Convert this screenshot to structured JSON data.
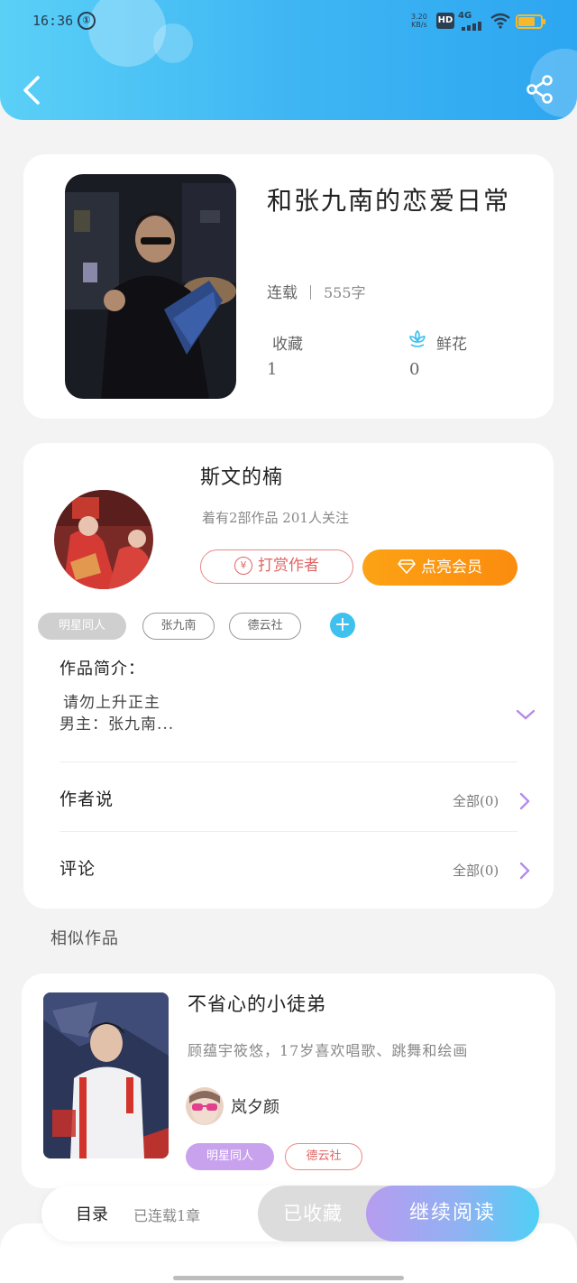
{
  "status_bar": {
    "time": "16:36",
    "notification_badge": "①",
    "net_speed_value": "3.20",
    "net_speed_unit": "KB/s",
    "hd": "HD",
    "network": "4G"
  },
  "book": {
    "title": "和张九南的恋爱日常",
    "status": "连载",
    "word_count": "555字",
    "favorites_label": "收藏",
    "favorites_value": "1",
    "flowers_label": "鲜花",
    "flowers_value": "0"
  },
  "author": {
    "name": "斯文的楠",
    "stats": "着有2部作品 201人关注",
    "reward_button": "打赏作者",
    "reward_icon_glyph": "¥",
    "vip_button": "点亮会员"
  },
  "tags": [
    "明星同人",
    "张九南",
    "德云社"
  ],
  "tag_add": "+",
  "intro": {
    "label": "作品简介：",
    "line1": "请勿上升正主",
    "line2": "男主：张九南..."
  },
  "author_says": {
    "label": "作者说",
    "right": "全部(0)"
  },
  "comments": {
    "label": "评论",
    "right": "全部(0)"
  },
  "similar": {
    "section_title": "相似作品",
    "title": "不省心的小徒弟",
    "description": "顾蕴宇筱悠，17岁喜欢唱歌、跳舞和绘画",
    "author": "岚夕颜",
    "tags": [
      "明星同人",
      "德云社"
    ]
  },
  "bottom_bar": {
    "toc_label": "目录",
    "toc_status": "已连载1章",
    "collected_button": "已收藏",
    "continue_button": "继续阅读"
  },
  "colors": {
    "header_gradient_start": "#5ad0f7",
    "header_gradient_end": "#2da6f1",
    "vip_orange": "#fb8c0e",
    "reward_red": "#e06565",
    "tag_purple": "#c9a2ee",
    "accent_cyan": "#3ec1ee",
    "chevron_purple": "#b58bea"
  }
}
